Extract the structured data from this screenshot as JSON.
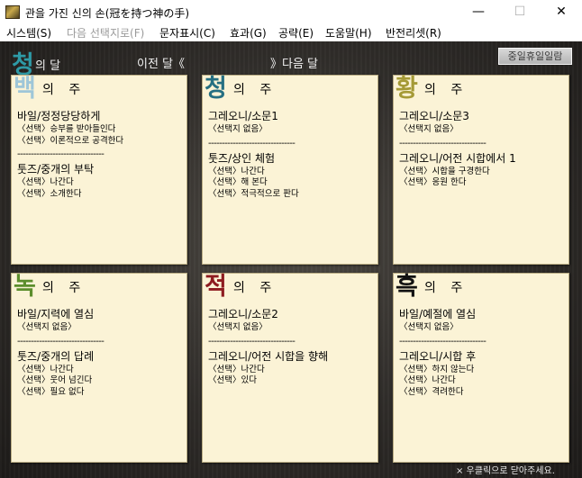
{
  "window": {
    "title": "관을 가진 신의 손(冠を持つ神の手)",
    "controls": {
      "minimize": "—",
      "maximize": "☐",
      "close": "✕"
    }
  },
  "menu": [
    {
      "label": "시스템(S)",
      "enabled": true
    },
    {
      "label": "다음 선택지로(F)",
      "enabled": false
    },
    {
      "label": "문자표시(C)",
      "enabled": true
    },
    {
      "label": "효과(G)",
      "enabled": true
    },
    {
      "label": "공략(E)",
      "enabled": true
    },
    {
      "label": "도움말(H)",
      "enabled": true
    },
    {
      "label": "반전리셋(R)",
      "enabled": true
    }
  ],
  "header": {
    "month_char": "청",
    "month_suffix": "의 달",
    "month_color": "#2e9aa6",
    "prev": "이전 달《",
    "next": "》다음 달",
    "holiday_button": "중일휴일일람"
  },
  "weeks": [
    {
      "char": "백",
      "title": "의 주",
      "color": "#9ec6d8",
      "sec1": {
        "main": "바일/정정당당하게",
        "choices": [
          "〈선택〉승부를 받아들인다",
          "〈선택〉이론적으로 공격한다"
        ]
      },
      "divider": "--------------------------------",
      "sec2": {
        "main": "툿즈/중개의 부탁",
        "choices": [
          "〈선택〉나간다",
          "〈선택〉소개한다"
        ]
      }
    },
    {
      "char": "청",
      "title": "의 주",
      "color": "#256f82",
      "sec1": {
        "main": "그레오니/소문1",
        "choices": [
          "〈선택지 없음〉"
        ]
      },
      "divider": "--------------------------------",
      "sec2": {
        "main": "툿즈/상인 체험",
        "choices": [
          "〈선택〉나간다",
          "〈선택〉해 본다",
          "〈선택〉적극적으로 판다"
        ]
      }
    },
    {
      "char": "황",
      "title": "의 주",
      "color": "#a59a36",
      "sec1": {
        "main": "그레오니/소문3",
        "choices": [
          "〈선택지 없음〉"
        ]
      },
      "divider": "--------------------------------",
      "sec2": {
        "main": "그레오니/어전 시합에서 1",
        "choices": [
          "〈선택〉시합을 구경한다",
          "〈선택〉응원 한다"
        ]
      }
    },
    {
      "char": "녹",
      "title": "의 주",
      "color": "#5c8e2c",
      "sec1": {
        "main": "바일/지력에 열심",
        "choices": [
          "〈선택지 없음〉"
        ]
      },
      "divider": "--------------------------------",
      "sec2": {
        "main": "툿즈/중개의 답례",
        "choices": [
          "〈선택〉나간다",
          "〈선택〉웃어 넘긴다",
          "〈선택〉필요 없다"
        ]
      }
    },
    {
      "char": "적",
      "title": "의 주",
      "color": "#8e1c20",
      "sec1": {
        "main": "그레오니/소문2",
        "choices": [
          "〈선택지 없음〉"
        ]
      },
      "divider": "--------------------------------",
      "sec2": {
        "main": "그레오니/어전 시합을 향해",
        "choices": [
          "〈선택〉나간다",
          "〈선택〉있다"
        ]
      }
    },
    {
      "char": "흑",
      "title": "의 주",
      "color": "#111111",
      "sec1": {
        "main": "바일/예절에 열심",
        "choices": [
          "〈선택지 없음〉"
        ]
      },
      "divider": "--------------------------------",
      "sec2": {
        "main": "그레오니/시합 후",
        "choices": [
          "〈선택〉하지 않는다",
          "〈선택〉나간다",
          "〈선택〉격려한다"
        ]
      }
    }
  ],
  "footer": {
    "hint": "× 우클릭으로 닫아주세요."
  }
}
